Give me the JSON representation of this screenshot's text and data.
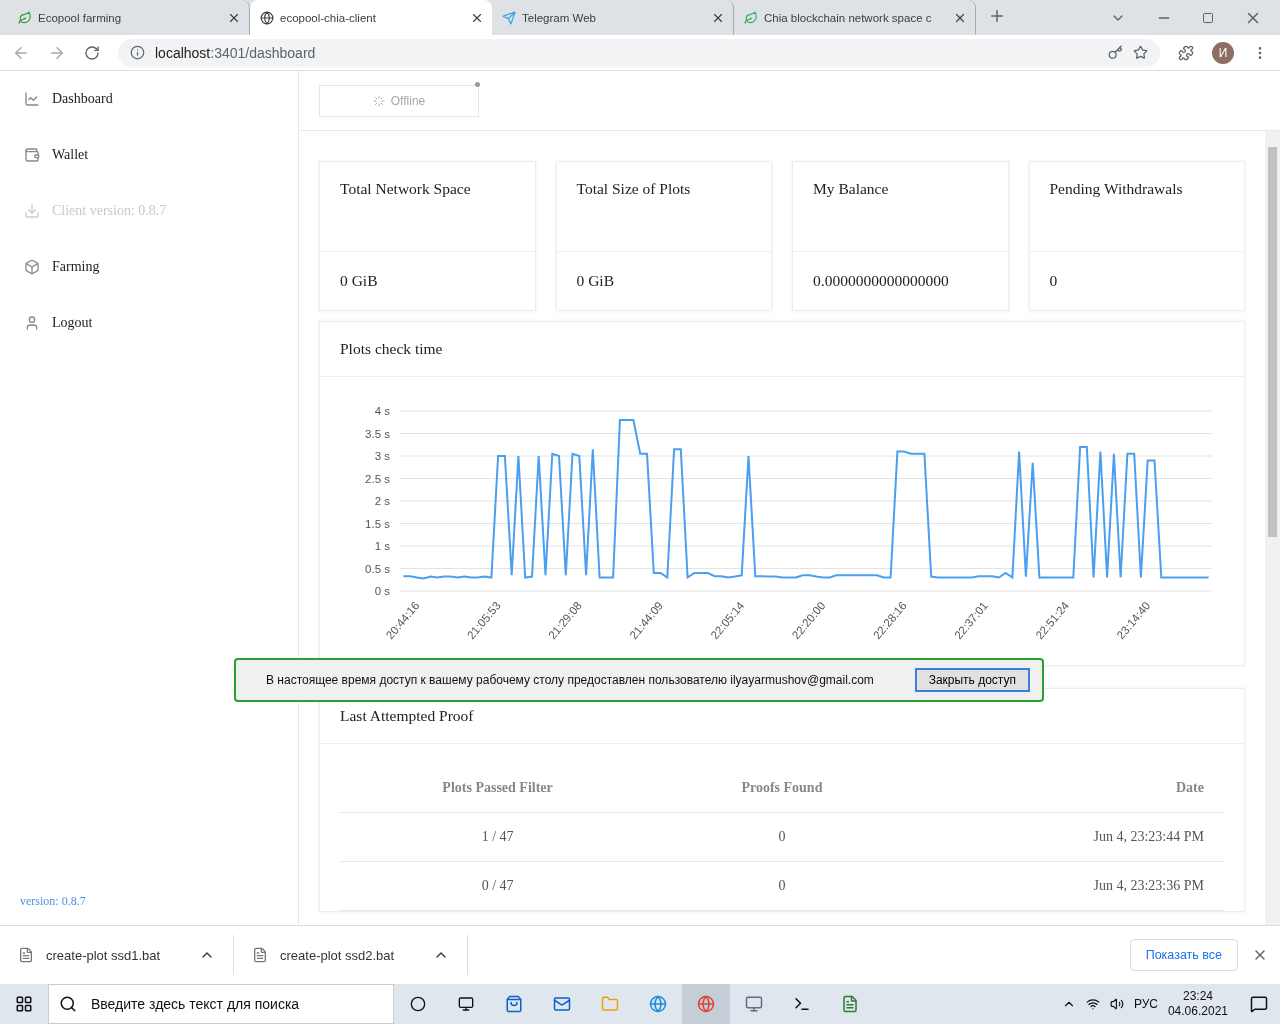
{
  "browser": {
    "tabs": [
      {
        "title": "Ecopool farming",
        "selected": false
      },
      {
        "title": "ecopool-chia-client",
        "selected": true
      },
      {
        "title": "Telegram Web",
        "selected": false
      },
      {
        "title": "Chia blockchain network space c",
        "selected": false
      }
    ],
    "address": {
      "host": "localhost",
      "rest": ":3401/dashboard"
    },
    "profile_initial": "И"
  },
  "sidebar": {
    "items": [
      {
        "label": "Dashboard",
        "disabled": false
      },
      {
        "label": "Wallet",
        "disabled": false
      },
      {
        "label": "Client version: 0.8.7",
        "disabled": true
      },
      {
        "label": "Farming",
        "disabled": false
      },
      {
        "label": "Logout",
        "disabled": false
      }
    ],
    "version": "version: 0.8.7"
  },
  "status": {
    "label": "Offline",
    "online": false
  },
  "stats": [
    {
      "title": "Total Network Space",
      "value": "0 GiB"
    },
    {
      "title": "Total Size of Plots",
      "value": "0 GiB"
    },
    {
      "title": "My Balance",
      "value": "0.0000000000000000"
    },
    {
      "title": "Pending Withdrawals",
      "value": "0"
    }
  ],
  "plots_check": {
    "title": "Plots check time",
    "chart_data": {
      "type": "line",
      "categories": [
        "20:44:16",
        null,
        null,
        null,
        null,
        null,
        null,
        null,
        null,
        null,
        null,
        null,
        "21:05:53",
        null,
        null,
        null,
        null,
        null,
        null,
        null,
        null,
        null,
        null,
        null,
        "21:29:08",
        null,
        null,
        null,
        null,
        null,
        null,
        null,
        null,
        null,
        null,
        null,
        "21:44:09",
        null,
        null,
        null,
        null,
        null,
        null,
        null,
        null,
        null,
        null,
        null,
        "22:05:14",
        null,
        null,
        null,
        null,
        null,
        null,
        null,
        null,
        null,
        null,
        null,
        "22:20:00",
        null,
        null,
        null,
        null,
        null,
        null,
        null,
        null,
        null,
        null,
        null,
        "22:28:16",
        null,
        null,
        null,
        null,
        null,
        null,
        null,
        null,
        null,
        null,
        null,
        "22:37:01",
        null,
        null,
        null,
        null,
        null,
        null,
        null,
        null,
        null,
        null,
        null,
        "22:51:24",
        null,
        null,
        null,
        null,
        null,
        null,
        null,
        null,
        null,
        null,
        null,
        "23:14:40",
        null,
        null,
        null,
        null,
        null,
        null,
        null,
        null,
        null,
        null,
        null
      ],
      "series": [
        {
          "color": "#4a9ff0",
          "values": [
            0.33,
            0.33,
            0.3,
            0.28,
            0.32,
            0.3,
            0.32,
            0.32,
            0.3,
            0.32,
            0.3,
            0.3,
            0.32,
            0.3,
            3.0,
            3.0,
            0.35,
            3.0,
            0.3,
            0.32,
            3.0,
            0.35,
            3.05,
            3.0,
            0.35,
            3.05,
            3.0,
            0.35,
            3.15,
            0.3,
            0.3,
            0.3,
            3.8,
            3.8,
            3.8,
            3.05,
            3.05,
            0.4,
            0.4,
            0.3,
            3.15,
            3.15,
            0.3,
            0.4,
            0.4,
            0.4,
            0.33,
            0.33,
            0.3,
            0.32,
            0.35,
            3.0,
            0.33,
            0.33,
            0.32,
            0.32,
            0.3,
            0.3,
            0.3,
            0.35,
            0.35,
            0.32,
            0.3,
            0.3,
            0.35,
            0.35,
            0.35,
            0.35,
            0.35,
            0.35,
            0.35,
            0.3,
            0.3,
            3.1,
            3.1,
            3.05,
            3.05,
            3.05,
            0.32,
            0.3,
            0.3,
            0.3,
            0.3,
            0.3,
            0.3,
            0.33,
            0.33,
            0.33,
            0.3,
            0.4,
            0.3,
            3.1,
            0.32,
            2.85,
            0.3,
            0.3,
            0.3,
            0.3,
            0.3,
            0.3,
            3.2,
            3.2,
            0.3,
            3.1,
            0.3,
            3.05,
            0.3,
            3.05,
            3.05,
            0.3,
            2.9,
            2.9,
            0.3,
            0.3,
            0.3,
            0.3,
            0.3,
            0.3,
            0.3,
            0.3
          ]
        }
      ],
      "ylim": [
        0,
        4
      ],
      "grid": true,
      "yticks": [
        {
          "value": 0,
          "label": "0 s"
        },
        {
          "value": 0.5,
          "label": "0.5 s"
        },
        {
          "value": 1,
          "label": "1 s"
        },
        {
          "value": 1.5,
          "label": "1.5 s"
        },
        {
          "value": 2,
          "label": "2 s"
        },
        {
          "value": 2.5,
          "label": "2.5 s"
        },
        {
          "value": 3,
          "label": "3 s"
        },
        {
          "value": 3.5,
          "label": "3.5 s"
        },
        {
          "value": 4,
          "label": "4 s"
        }
      ]
    }
  },
  "last_proof": {
    "title": "Last Attempted Proof",
    "columns": [
      "Plots Passed Filter",
      "Proofs Found",
      "Date"
    ],
    "rows": [
      [
        "1 / 47",
        "0",
        "Jun 4, 23:23:44 PM"
      ],
      [
        "0 / 47",
        "0",
        "Jun 4, 23:23:36 PM"
      ]
    ]
  },
  "sharing_banner": {
    "message": "В настоящее время доступ к вашему рабочему столу предоставлен пользователю ilyayarmushov@gmail.com",
    "button": "Закрыть доступ"
  },
  "downloads": {
    "files": [
      "create-plot ssd1.bat",
      "create-plot ssd2.bat"
    ],
    "show_all": "Показать все"
  },
  "taskbar": {
    "search_placeholder": "Введите здесь текст для поиска",
    "language": "РУС",
    "time": "23:24",
    "date": "04.06.2021"
  }
}
